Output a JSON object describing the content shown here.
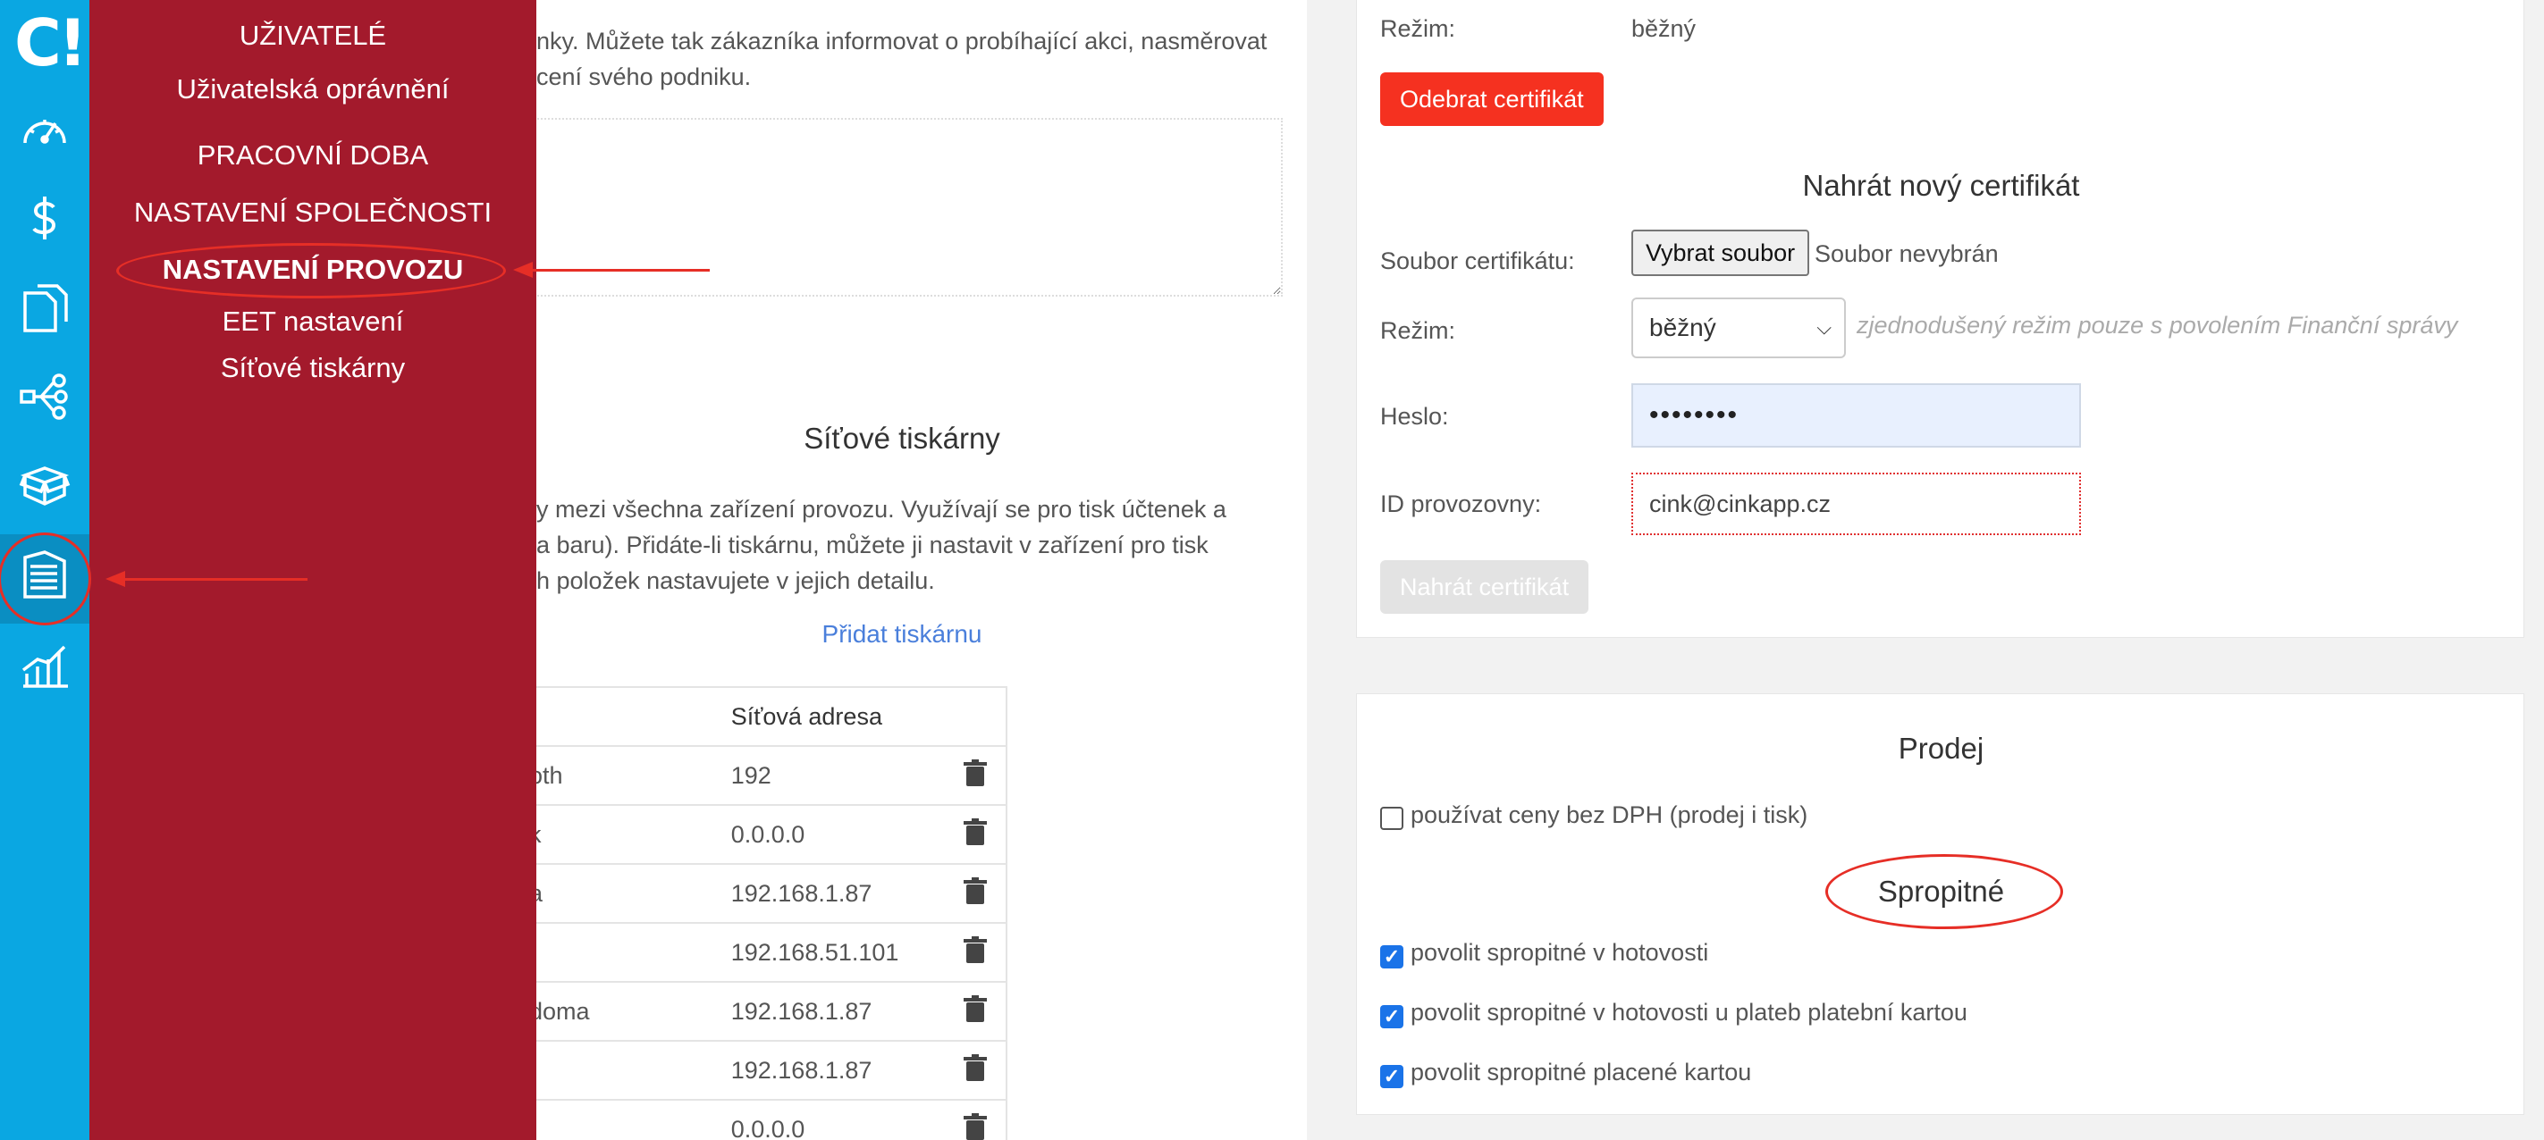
{
  "rail": {
    "logo": "C!",
    "icons": [
      "speedometer-icon",
      "dollar-icon",
      "documents-icon",
      "network-icon",
      "boxes-icon",
      "building-icon",
      "analytics-icon"
    ]
  },
  "menu": {
    "items": [
      {
        "label": "UŽIVATELÉ"
      },
      {
        "label": "Uživatelská oprávnění"
      },
      {
        "label": "PRACOVNÍ DOBA"
      },
      {
        "label": "NASTAVENÍ SPOLEČNOSTI"
      },
      {
        "label": "NASTAVENÍ PROVOZU",
        "selected": true
      },
      {
        "label": "EET nastavení"
      },
      {
        "label": "Síťové tiskárny"
      }
    ]
  },
  "middle": {
    "intro_line1": "nky. Můžete tak zákazníka informovat o probíhající akci, nasměrovat",
    "intro_line2": "cení svého podniku.",
    "printers_title": "Síťové tiskárny",
    "printers_desc_line1": "y mezi všechna zařízení provozu. Využívají se pro tisk účtenek a",
    "printers_desc_line2": "a baru). Přidáte-li tiskárnu, můžete ji nastavit v zařízení pro tisk",
    "printers_desc_line3": "h položek nastavujete v jejich detailu.",
    "add_printer_link": "Přidat tiskárnu",
    "table_header_address": "Síťová adresa",
    "rows": [
      {
        "name": "oth",
        "address": "192"
      },
      {
        "name": "k",
        "address": "0.0.0.0"
      },
      {
        "name": "a",
        "address": "192.168.1.87"
      },
      {
        "name": "",
        "address": "192.168.51.101"
      },
      {
        "name": "doma",
        "address": "192.168.1.87"
      },
      {
        "name": "",
        "address": "192.168.1.87"
      },
      {
        "name": "",
        "address": "0.0.0.0"
      }
    ]
  },
  "certificate": {
    "mode_label": "Režim:",
    "mode_value": "běžný",
    "remove_button": "Odebrat certifikát",
    "upload_title": "Nahrát nový certifikát",
    "file_label": "Soubor certifikátu:",
    "file_button": "Vybrat soubor",
    "file_status": "Soubor nevybrán",
    "mode2_label": "Režim:",
    "mode2_selected": "běžný",
    "mode_hint": "zjednodušený režim pouze s povolením Finanční správy",
    "password_label": "Heslo:",
    "password_value": "••••••••",
    "id_label": "ID provozovny:",
    "id_value": "cink@cinkapp.cz",
    "upload_button": "Nahrát certifikát"
  },
  "sales": {
    "title": "Prodej",
    "vat_option": "používat ceny bez DPH (prodej i tisk)",
    "vat_checked": false,
    "tips_title": "Spropitné",
    "tips": [
      {
        "label": "povolit spropitné v hotovosti",
        "checked": true
      },
      {
        "label": "povolit spropitné v hotovosti u plateb platební kartou",
        "checked": true
      },
      {
        "label": "povolit spropitné placené kartou",
        "checked": true
      }
    ]
  },
  "colors": {
    "rail": "#0aa7e2",
    "menu": "#a31a2c",
    "danger": "#f53120",
    "annotation": "#e62e26",
    "link": "#4a7fdb"
  }
}
